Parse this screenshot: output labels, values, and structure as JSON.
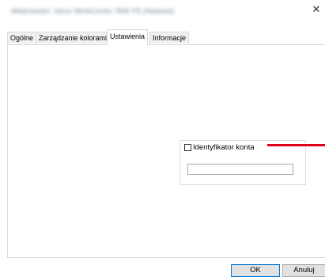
{
  "window": {
    "title": "Właściwości: Xerox WorkCentre 7845 PS (Network)",
    "close_glyph": "✕"
  },
  "tabs": [
    {
      "label": "Ogólne",
      "active": false
    },
    {
      "label": "Zarządzanie kolorami",
      "active": false
    },
    {
      "label": "Ustawienia",
      "active": true
    },
    {
      "label": "Informacje",
      "active": false
    }
  ],
  "settings": {
    "account_id_label": "Identyfikator konta",
    "account_id_checked": false,
    "account_id_value": ""
  },
  "annotation": {
    "color": "#e0001b"
  },
  "buttons": {
    "ok": "OK",
    "cancel": "Anuluj"
  }
}
